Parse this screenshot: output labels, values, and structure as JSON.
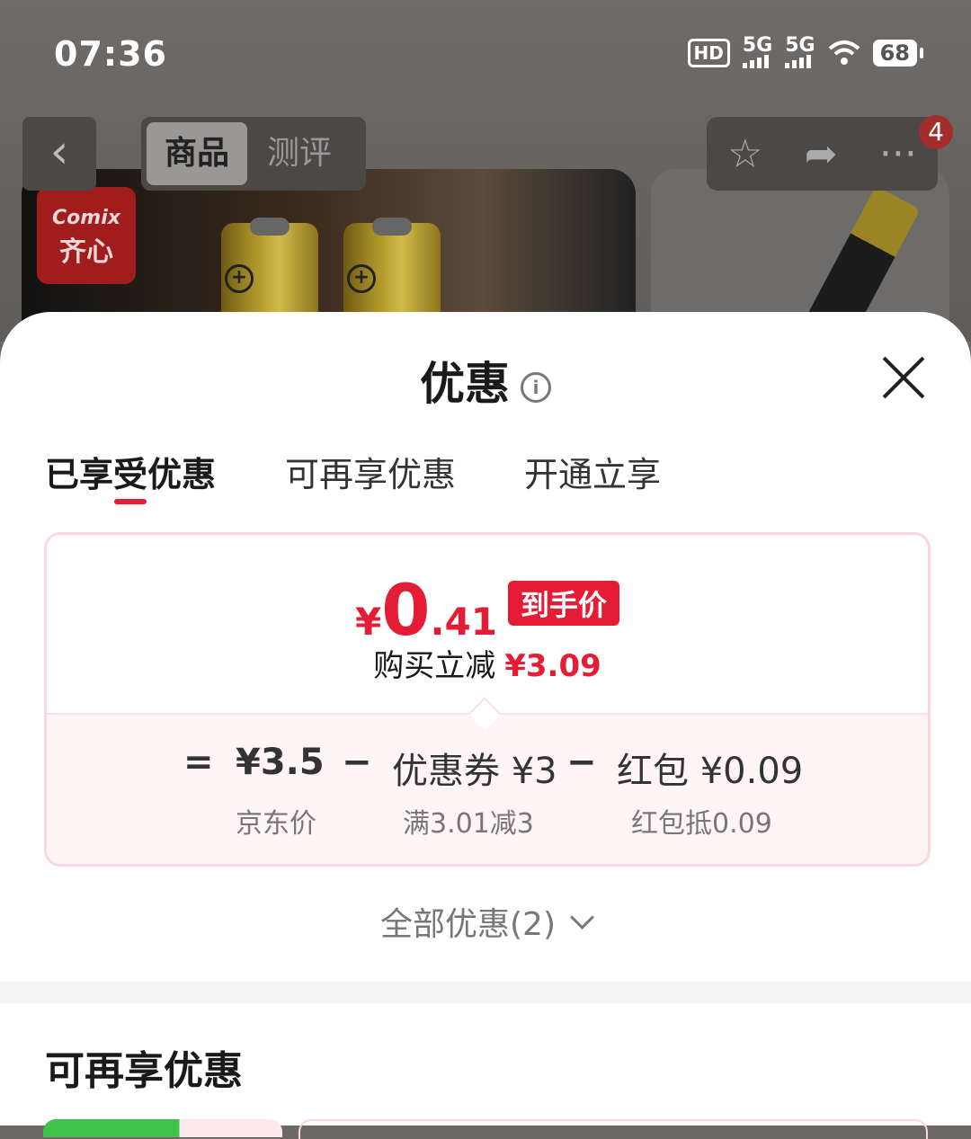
{
  "status_bar": {
    "time": "07:36",
    "hd": "HD",
    "net1": "5G",
    "net2": "5G",
    "battery": "68"
  },
  "top_nav": {
    "back_icon": "chevron-left-icon",
    "tabs": [
      {
        "label": "商品"
      },
      {
        "label": "测评"
      }
    ],
    "actions": [
      "star-icon",
      "share-icon",
      "more-icon"
    ],
    "cart_badge": "4"
  },
  "product": {
    "brand_en": "Comix",
    "brand_zh": "齐心"
  },
  "sheet": {
    "title": "优惠",
    "tabs": [
      {
        "label": "已享受优惠"
      },
      {
        "label": "可再享优惠"
      },
      {
        "label": "开通立享"
      }
    ],
    "price_card": {
      "currency": "¥",
      "price_int": "0",
      "price_dec": ".41",
      "badge": "到手价",
      "save_label": "购买立减",
      "save_amount": "¥3.09",
      "breakdown": {
        "eq": "=",
        "jd_price": "¥3.5",
        "jd_price_label": "京东价",
        "minus1": "−",
        "coupon": "优惠券 ¥3",
        "coupon_label": "满3.01减3",
        "minus2": "−",
        "redpacket": "红包 ¥0.09",
        "redpacket_label": "红包抵0.09"
      }
    },
    "all_promos": "全部优惠(2)",
    "section_title": "可再享优惠"
  },
  "colors": {
    "accent": "#e51c35",
    "green": "#3fc34a"
  }
}
